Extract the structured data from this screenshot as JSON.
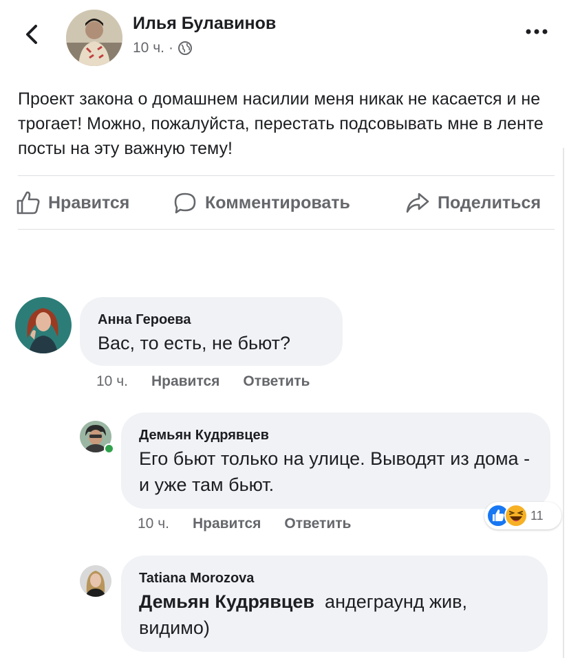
{
  "post": {
    "author": "Илья Булавинов",
    "time": "10 ч.",
    "separator": "·",
    "text": "Проект закона о домашнем насилии меня никак не касается и не трогает! Можно, пожалуйста, перестать подсовывать мне в ленте посты на эту важную тему!"
  },
  "actions": {
    "like": "Нравится",
    "comment": "Комментировать",
    "share": "Поделиться"
  },
  "comments": [
    {
      "name": "Анна Героева",
      "text": "Вас, то есть, не бьют?",
      "time": "10 ч.",
      "like": "Нравится",
      "reply": "Ответить"
    },
    {
      "name": "Демьян Кудрявцев",
      "text": "Его бьют только на улице. Выводят из дома - и уже там бьют.",
      "time": "10 ч.",
      "like": "Нравится",
      "reply": "Ответить",
      "reactions_count": "11"
    },
    {
      "name": "Tatiana Morozova",
      "mention": "Демьян Кудрявцев",
      "text": "андеграунд жив, видимо)"
    }
  ],
  "icons": {
    "back": "chevron-left-icon",
    "more": "more-dots-icon",
    "audience": "globe-icon",
    "like": "thumbs-up-icon",
    "comment": "comment-bubble-icon",
    "share": "share-arrow-icon",
    "reaction_like": "like-reaction-icon",
    "reaction_haha": "haha-reaction-icon"
  },
  "colors": {
    "text": "#1c1e21",
    "secondary": "#65676b",
    "bubble": "#f0f2f5",
    "like_blue": "#1877f2",
    "haha_yellow": "#f7b125",
    "online_green": "#31a24c"
  }
}
